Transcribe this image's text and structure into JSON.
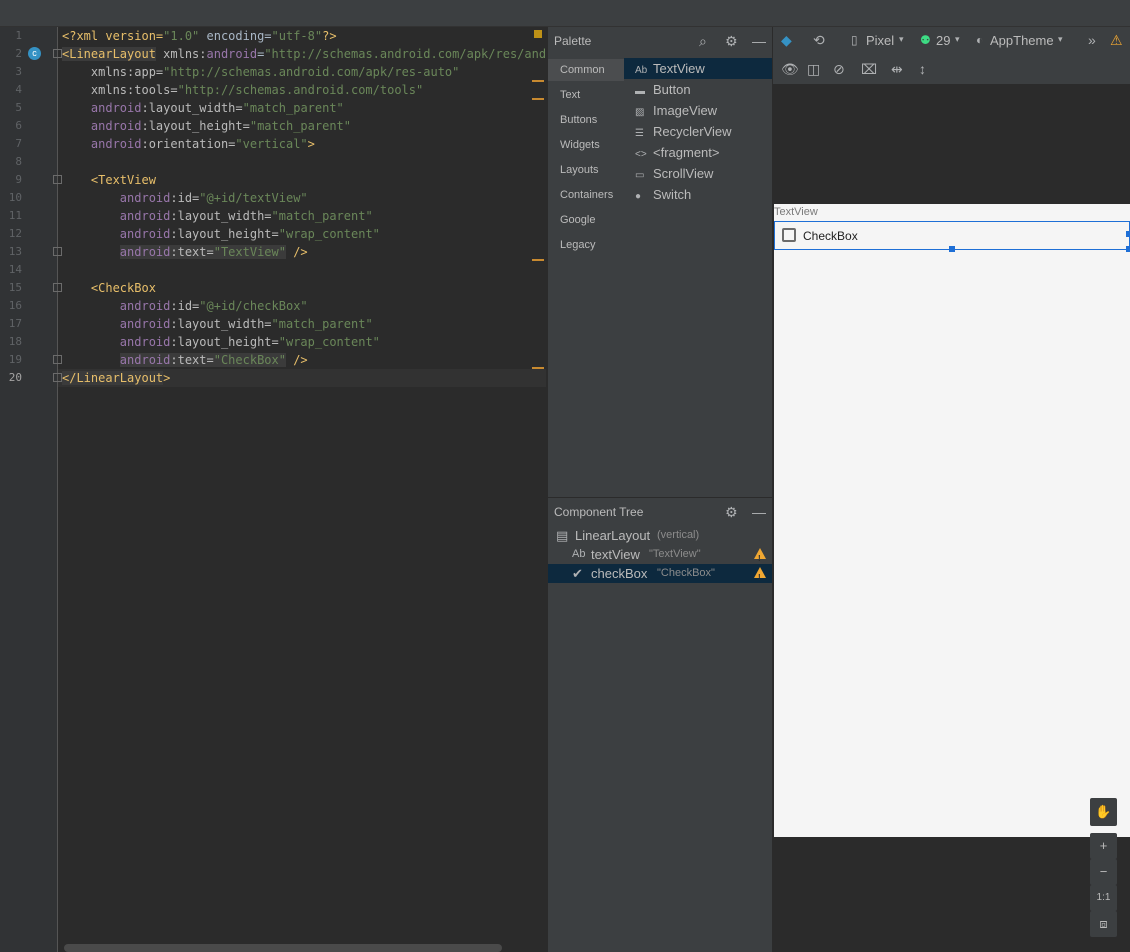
{
  "editor": {
    "lines": [
      {
        "n": "1",
        "parts": [
          {
            "t": "<?xml version=",
            "c": "t-tag"
          },
          {
            "t": "\"1.0\"",
            "c": "t-val"
          },
          {
            "t": " encoding=",
            "c": "t-plain"
          },
          {
            "t": "\"utf-8\"",
            "c": "t-val"
          },
          {
            "t": "?>",
            "c": "t-tag"
          }
        ]
      },
      {
        "n": "2",
        "parts": [
          {
            "t": "<LinearLayout",
            "c": "t-tag t-hl"
          },
          {
            "t": " xmlns:",
            "c": "t-attr"
          },
          {
            "t": "android",
            "c": "t-ns"
          },
          {
            "t": "=",
            "c": "t-plain"
          },
          {
            "t": "\"http://schemas.android.com/apk/res/andro",
            "c": "t-val"
          }
        ]
      },
      {
        "n": "3",
        "parts": [
          {
            "t": "    xmlns:app=",
            "c": "t-attr"
          },
          {
            "t": "\"http://schemas.android.com/apk/res-auto\"",
            "c": "t-val"
          }
        ]
      },
      {
        "n": "4",
        "parts": [
          {
            "t": "    xmlns:tools=",
            "c": "t-attr"
          },
          {
            "t": "\"http://schemas.android.com/tools\"",
            "c": "t-val"
          }
        ]
      },
      {
        "n": "5",
        "parts": [
          {
            "t": "    android",
            "c": "t-ns"
          },
          {
            "t": ":layout_width=",
            "c": "t-attr"
          },
          {
            "t": "\"match_parent\"",
            "c": "t-val"
          }
        ]
      },
      {
        "n": "6",
        "parts": [
          {
            "t": "    android",
            "c": "t-ns"
          },
          {
            "t": ":layout_height=",
            "c": "t-attr"
          },
          {
            "t": "\"match_parent\"",
            "c": "t-val"
          }
        ]
      },
      {
        "n": "7",
        "parts": [
          {
            "t": "    android",
            "c": "t-ns"
          },
          {
            "t": ":orientation=",
            "c": "t-attr"
          },
          {
            "t": "\"vertical\"",
            "c": "t-val"
          },
          {
            "t": ">",
            "c": "t-tag"
          }
        ]
      },
      {
        "n": "8",
        "parts": []
      },
      {
        "n": "9",
        "parts": [
          {
            "t": "    <TextView",
            "c": "t-tag"
          }
        ]
      },
      {
        "n": "10",
        "parts": [
          {
            "t": "        android",
            "c": "t-ns"
          },
          {
            "t": ":id=",
            "c": "t-attr"
          },
          {
            "t": "\"@+id/textView\"",
            "c": "t-val"
          }
        ]
      },
      {
        "n": "11",
        "parts": [
          {
            "t": "        android",
            "c": "t-ns"
          },
          {
            "t": ":layout_width=",
            "c": "t-attr"
          },
          {
            "t": "\"match_parent\"",
            "c": "t-val"
          }
        ]
      },
      {
        "n": "12",
        "parts": [
          {
            "t": "        android",
            "c": "t-ns"
          },
          {
            "t": ":layout_height=",
            "c": "t-attr"
          },
          {
            "t": "\"wrap_content\"",
            "c": "t-val"
          }
        ]
      },
      {
        "n": "13",
        "parts": [
          {
            "t": "        ",
            "c": "t-plain"
          },
          {
            "t": "android",
            "c": "t-ns t-hl"
          },
          {
            "t": ":text=",
            "c": "t-attr t-hl"
          },
          {
            "t": "\"TextView\"",
            "c": "t-val t-hl"
          },
          {
            "t": " />",
            "c": "t-tag"
          }
        ]
      },
      {
        "n": "14",
        "parts": []
      },
      {
        "n": "15",
        "parts": [
          {
            "t": "    <CheckBox",
            "c": "t-tag"
          }
        ]
      },
      {
        "n": "16",
        "parts": [
          {
            "t": "        android",
            "c": "t-ns"
          },
          {
            "t": ":id=",
            "c": "t-attr"
          },
          {
            "t": "\"@+id/checkBox\"",
            "c": "t-val"
          }
        ]
      },
      {
        "n": "17",
        "parts": [
          {
            "t": "        android",
            "c": "t-ns"
          },
          {
            "t": ":layout_width=",
            "c": "t-attr"
          },
          {
            "t": "\"match_parent\"",
            "c": "t-val"
          }
        ]
      },
      {
        "n": "18",
        "parts": [
          {
            "t": "        android",
            "c": "t-ns"
          },
          {
            "t": ":layout_height=",
            "c": "t-attr"
          },
          {
            "t": "\"wrap_content\"",
            "c": "t-val"
          }
        ]
      },
      {
        "n": "19",
        "parts": [
          {
            "t": "        ",
            "c": "t-plain"
          },
          {
            "t": "android",
            "c": "t-ns t-hl"
          },
          {
            "t": ":text=",
            "c": "t-attr t-hl"
          },
          {
            "t": "\"CheckBox\"",
            "c": "t-val t-hl"
          },
          {
            "t": " />",
            "c": "t-tag"
          }
        ]
      },
      {
        "n": "20",
        "parts": [
          {
            "t": "</LinearLayout",
            "c": "t-tag t-hl"
          },
          {
            "t": ">",
            "c": "t-tag"
          }
        ]
      }
    ],
    "gutter_icon": "c"
  },
  "palette": {
    "title": "Palette",
    "categories": [
      "Common",
      "Text",
      "Buttons",
      "Widgets",
      "Layouts",
      "Containers",
      "Google",
      "Legacy"
    ],
    "items": [
      {
        "icon": "Ab",
        "label": "TextView"
      },
      {
        "icon": "▬",
        "label": "Button"
      },
      {
        "icon": "▨",
        "label": "ImageView"
      },
      {
        "icon": "☰",
        "label": "RecyclerView"
      },
      {
        "icon": "<>",
        "label": "<fragment>"
      },
      {
        "icon": "▭",
        "label": "ScrollView"
      },
      {
        "icon": "●",
        "label": "Switch"
      }
    ]
  },
  "tree": {
    "title": "Component Tree",
    "rows": [
      {
        "icon": "▤",
        "name": "LinearLayout",
        "sub": "(vertical)"
      },
      {
        "icon": "Ab",
        "name": "textView",
        "sub": "\"TextView\""
      },
      {
        "icon": "✔",
        "name": "checkBox",
        "sub": "\"CheckBox\""
      }
    ]
  },
  "toolbar": {
    "device": "Pixel",
    "api": "29",
    "theme": "AppTheme"
  },
  "preview": {
    "textview": "TextView",
    "checkbox": "CheckBox"
  },
  "zoom": {
    "plus": "+",
    "minus": "−",
    "one_to_one": "1:1"
  }
}
